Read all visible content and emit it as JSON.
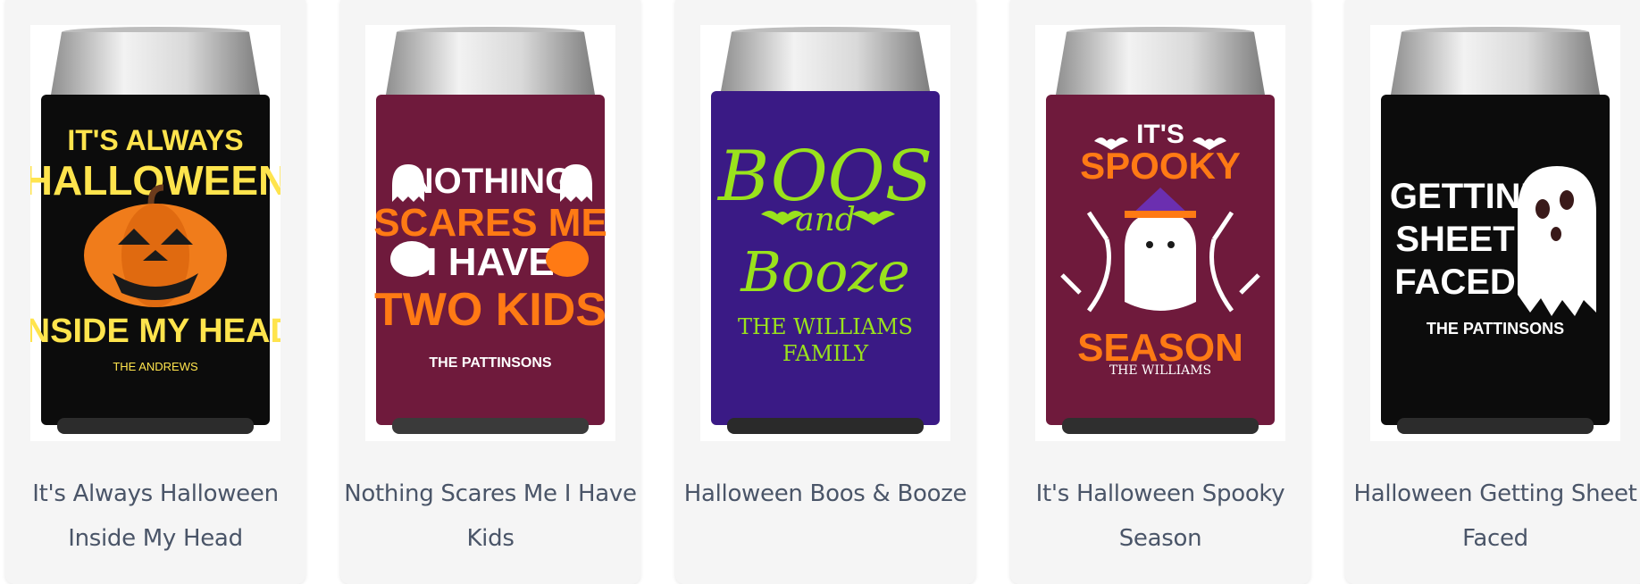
{
  "products": [
    {
      "title": "It's Always Halloween Inside My Head",
      "sleeve_color": "#0c0c0c",
      "design": [
        "IT'S ALWAYS",
        "HALLOWEEN",
        "INSIDE MY HEAD",
        "THE ANDREWS"
      ],
      "design_colors": [
        "#ffe44d",
        "#ffe44d"
      ],
      "icons": [
        "jack-o-lantern-icon"
      ]
    },
    {
      "title": "Nothing Scares Me I Have Kids",
      "sleeve_color": "#6f1a3c",
      "design": [
        "NOTHING",
        "SCARES ME",
        "I HAVE",
        "TWO KIDS",
        "THE PATTINSONS"
      ],
      "design_colors": [
        "#ffffff",
        "#ff7a14"
      ],
      "icons": [
        "ghost-icon",
        "ghost-icon",
        "pumpkin-icon",
        "pumpkin-icon"
      ]
    },
    {
      "title": "Halloween Boos & Booze",
      "sleeve_color": "#3a1a85",
      "design": [
        "BOOS",
        "and",
        "Booze",
        "THE WILLIAMS",
        "FAMILY"
      ],
      "design_colors": [
        "#9ae21c",
        "#9ae21c"
      ],
      "icons": [
        "bat-icon",
        "bat-icon"
      ]
    },
    {
      "title": "It's Halloween Spooky Season",
      "sleeve_color": "#6f1a3c",
      "design": [
        "IT'S",
        "SPOOKY",
        "SEASON",
        "THE WILLIAMS"
      ],
      "design_colors": [
        "#ffffff",
        "#ff7a14"
      ],
      "icons": [
        "bat-icon",
        "ghost-witch-icon",
        "tree-icon"
      ]
    },
    {
      "title": "Halloween Getting Sheet Faced",
      "sleeve_color": "#0c0c0c",
      "design": [
        "GETTIN'",
        "SHEET",
        "FACED",
        "THE PATTINSONS"
      ],
      "design_colors": [
        "#ffffff",
        "#ffffff"
      ],
      "icons": [
        "ghost-icon"
      ]
    }
  ]
}
